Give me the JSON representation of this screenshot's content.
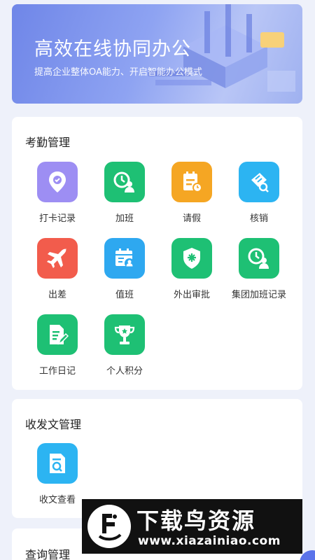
{
  "banner": {
    "title": "高效在线协同办公",
    "subtitle": "提高企业整体OA能力、开启智能办公模式"
  },
  "sections": [
    {
      "title": "考勤管理",
      "items": [
        {
          "label": "打卡记录",
          "icon": "location-pin-icon",
          "color": "#9d8ef3"
        },
        {
          "label": "加班",
          "icon": "overtime-clock-person-icon",
          "color": "#1ec074"
        },
        {
          "label": "请假",
          "icon": "leave-calendar-icon",
          "color": "#f5a623"
        },
        {
          "label": "核销",
          "icon": "verify-ticket-icon",
          "color": "#2cb4f2"
        },
        {
          "label": "出差",
          "icon": "airplane-icon",
          "color": "#f25c4c"
        },
        {
          "label": "值班",
          "icon": "duty-calendar-person-icon",
          "color": "#2ea8f0"
        },
        {
          "label": "外出审批",
          "icon": "shield-approval-icon",
          "color": "#1ec074"
        },
        {
          "label": "集团加班记录",
          "icon": "group-overtime-icon",
          "color": "#1ec074"
        },
        {
          "label": "工作日记",
          "icon": "work-diary-icon",
          "color": "#1ec074"
        },
        {
          "label": "个人积分",
          "icon": "trophy-icon",
          "color": "#1ec074"
        }
      ]
    },
    {
      "title": "收发文管理",
      "items": [
        {
          "label": "收文查看",
          "icon": "document-search-icon",
          "color": "#2cb4f2"
        }
      ]
    },
    {
      "title": "查询管理",
      "items": []
    }
  ],
  "watermark": {
    "title": "下载鸟资源",
    "url": "www.xiazainiao.com"
  }
}
